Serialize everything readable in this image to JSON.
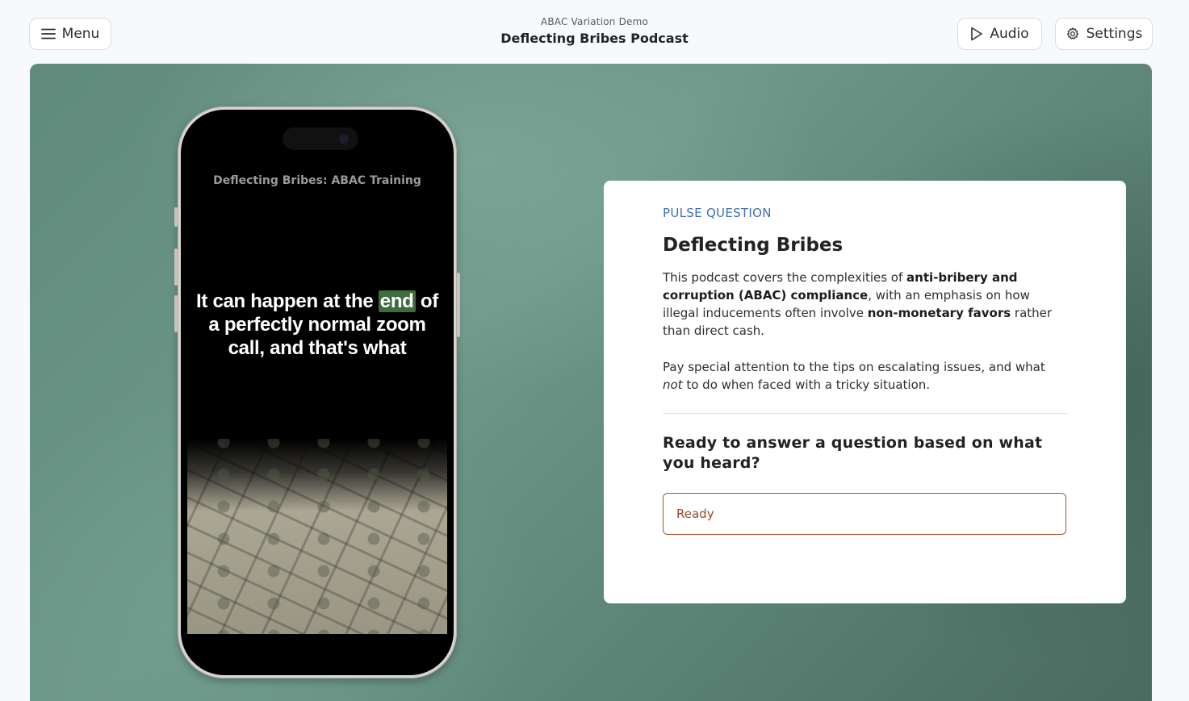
{
  "header": {
    "menu_label": "Menu",
    "subtitle": "ABAC Variation Demo",
    "title": "Deflecting Bribes Podcast",
    "audio_label": "Audio",
    "settings_label": "Settings"
  },
  "video": {
    "title": "Deflecting Bribes: ABAC Training",
    "caption_before": "It can happen at the ",
    "caption_highlight": "end",
    "caption_after": " of a perfectly normal zoom call, and that's what"
  },
  "card": {
    "eyebrow": "PULSE QUESTION",
    "title": "Deflecting Bribes",
    "p1_a": "This podcast covers the complexities of ",
    "p1_b": "anti-bribery and corruption (ABAC) compliance",
    "p1_c": ", with an emphasis on how illegal inducements often involve ",
    "p1_d": "non-monetary favors",
    "p1_e": " rather than direct cash.",
    "p2_a": "Pay special attention to the tips on escalating issues, and what ",
    "p2_b": "not",
    "p2_c": " to do when faced with a tricky situation.",
    "prompt": "Ready to answer a question based on what you heard?",
    "ready_label": "Ready"
  },
  "icons": {
    "menu": "hamburger-icon",
    "audio": "play-icon",
    "settings": "gear-icon"
  },
  "colors": {
    "accent_blue": "#3f6fb5",
    "ready_border": "#a9552f",
    "caption_highlight": "#3e6b3f"
  }
}
